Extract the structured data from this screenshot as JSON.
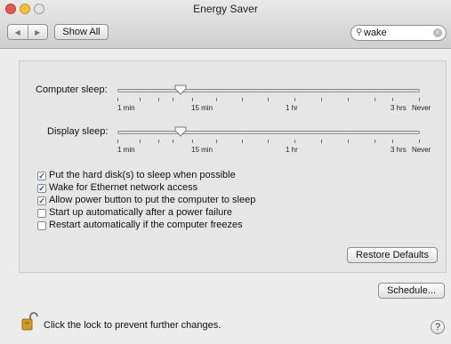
{
  "window": {
    "title": "Energy Saver"
  },
  "toolbar": {
    "show_all_label": "Show All",
    "search_value": "wake"
  },
  "sliders": [
    {
      "label": "Computer sleep:",
      "value_label": "15 min",
      "value_fraction": 0.21,
      "tick_labels": [
        "1 min",
        "15 min",
        "1 hr",
        "3 hrs",
        "Never"
      ]
    },
    {
      "label": "Display sleep:",
      "value_label": "15 min",
      "value_fraction": 0.21,
      "tick_labels": [
        "1 min",
        "15 min",
        "1 hr",
        "3 hrs",
        "Never"
      ]
    }
  ],
  "options": [
    {
      "label": "Put the hard disk(s) to sleep when possible",
      "checked": true
    },
    {
      "label": "Wake for Ethernet network access",
      "checked": true
    },
    {
      "label": "Allow power button to put the computer to sleep",
      "checked": true
    },
    {
      "label": "Start up automatically after a power failure",
      "checked": false
    },
    {
      "label": "Restart automatically if the computer freezes",
      "checked": false
    }
  ],
  "buttons": {
    "restore_defaults": "Restore Defaults",
    "schedule": "Schedule..."
  },
  "footer": {
    "lock_text": "Click the lock to prevent further changes.",
    "help": "?"
  },
  "icons": {
    "back": "back-arrow-icon",
    "forward": "forward-arrow-icon",
    "search": "magnifier-icon",
    "clear": "clear-icon",
    "lock": "lock-icon",
    "help": "help-icon"
  },
  "colors": {
    "accent": "#1a4f8f",
    "close": "#e25a4f",
    "minimize": "#f1be3f"
  }
}
